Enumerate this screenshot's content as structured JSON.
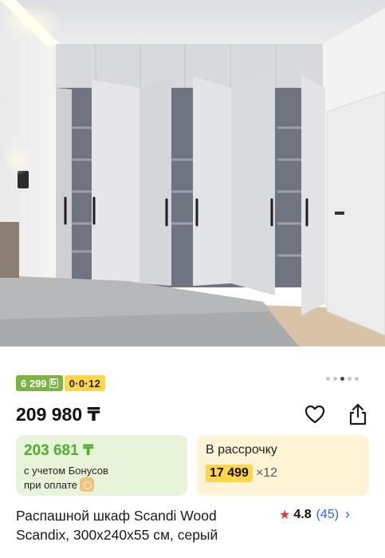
{
  "product": {
    "bonus_badge": "6 299",
    "bonus_badge_currency": "Б",
    "installment_badge": "0·0·12",
    "price": "209 980 ₸",
    "bonus_card": {
      "amount": "203 681 ₸",
      "line1": "с учетом Бонусов",
      "line2": "при оплате"
    },
    "installment_card": {
      "label": "В рассрочку",
      "monthly": "17 499",
      "multiplier": "×12"
    },
    "title": "Распашной шкаф Scandi Wood Scandix, 300x240x55 см, серый",
    "rating": {
      "score": "4.8",
      "count": "(45)"
    }
  },
  "carousel": {
    "count": 5,
    "active_index": 2
  },
  "icons": {
    "favorite": "heart-icon",
    "share": "share-icon",
    "star": "star-icon",
    "chevron": "chevron-right-icon",
    "coin": "bonus-coin-icon"
  },
  "colors": {
    "bonus_green": "#7cb342",
    "bonus_card_bg": "#e7f4d9",
    "installment_yellow": "#ffd54a",
    "installment_card_bg": "#fff5d6",
    "rating_star": "#e53935",
    "link_blue": "#2962ff"
  }
}
